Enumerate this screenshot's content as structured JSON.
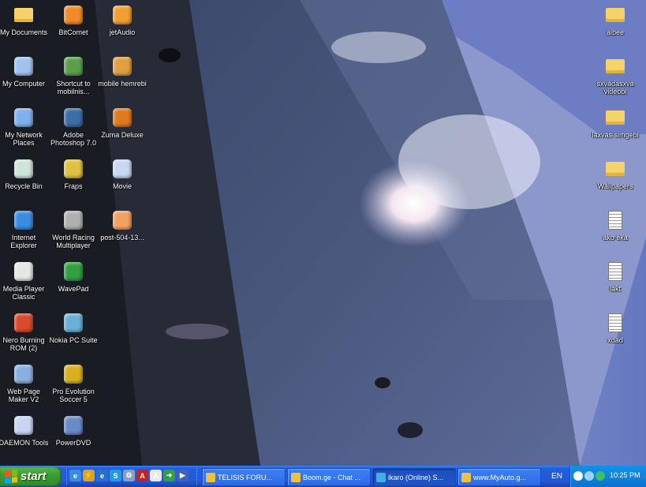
{
  "desktop": {
    "left_icons": [
      {
        "label": "My Documents",
        "icon": "folder-documents-icon",
        "color": "#f5d36b"
      },
      {
        "label": "My Computer",
        "icon": "computer-icon",
        "color": "#9fc3ee"
      },
      {
        "label": "My Network Places",
        "icon": "network-icon",
        "color": "#7fb0ec"
      },
      {
        "label": "Recycle Bin",
        "icon": "recycle-bin-icon",
        "color": "#cfe3d8"
      },
      {
        "label": "Internet Explorer",
        "icon": "internet-explorer-icon",
        "color": "#3b8be0"
      },
      {
        "label": "Media Player Classic",
        "icon": "media-player-icon",
        "color": "#e6e6e6"
      },
      {
        "label": "Nero Burning ROM (2)",
        "icon": "nero-icon",
        "color": "#d94a2a"
      },
      {
        "label": "Web Page Maker V2",
        "icon": "web-page-maker-icon",
        "color": "#8ab0e0"
      },
      {
        "label": "DAEMON Tools",
        "icon": "daemon-tools-icon",
        "color": "#c9d4f0"
      }
    ],
    "middle_icons": [
      {
        "label": "BitComet",
        "icon": "bitcomet-icon",
        "color": "#f08a2a"
      },
      {
        "label": "Shortcut to mobilnis...",
        "icon": "phone-icon",
        "color": "#5aa04a"
      },
      {
        "label": "Adobe Photoshop 7.0",
        "icon": "photoshop-icon",
        "color": "#3a6ea5"
      },
      {
        "label": "Fraps",
        "icon": "fraps-icon",
        "color": "#e0c040"
      },
      {
        "label": "World Racing Multiplayer",
        "icon": "world-racing-icon",
        "color": "#b0b0b0"
      },
      {
        "label": "WavePad",
        "icon": "wavepad-icon",
        "color": "#30a040"
      },
      {
        "label": "Nokia PC Suite",
        "icon": "nokia-icon",
        "color": "#6ab0d8"
      },
      {
        "label": "Pro Evolution Soccer 5",
        "icon": "pes-icon",
        "color": "#d8b020"
      },
      {
        "label": "PowerDVD",
        "icon": "powerdvd-icon",
        "color": "#6a8ac8"
      }
    ],
    "third_icons": [
      {
        "label": "jetAudio",
        "icon": "jetaudio-icon",
        "color": "#f0a030"
      },
      {
        "label": "mobile hemrebi",
        "icon": "mobile-icon",
        "color": "#e0a040"
      },
      {
        "label": "Zuma Deluxe",
        "icon": "zuma-icon",
        "color": "#e07a20"
      },
      {
        "label": "Movie",
        "icon": "movie-file-icon",
        "color": "#c8d8f0"
      },
      {
        "label": "post-504-13...",
        "icon": "image-file-icon",
        "color": "#f0a060"
      }
    ],
    "right_icons": [
      {
        "label": "albee",
        "icon": "folder-icon",
        "color": "#f5d36b"
      },
      {
        "label": "sxvadasxva videobi",
        "icon": "folder-icon",
        "color": "#f5d36b"
      },
      {
        "label": "laxvas simgebi",
        "icon": "folder-icon",
        "color": "#f5d36b"
      },
      {
        "label": "Wallpapers",
        "icon": "folder-icon",
        "color": "#f5d36b"
      },
      {
        "label": "ako eka",
        "icon": "text-file-icon",
        "color": "#ffffff"
      },
      {
        "label": "lakt",
        "icon": "text-file-icon",
        "color": "#ffffff"
      },
      {
        "label": "xdad",
        "icon": "text-file-icon",
        "color": "#ffffff"
      }
    ]
  },
  "taskbar": {
    "start_label": "start",
    "quick_launch": [
      {
        "icon": "ie-icon",
        "color": "#3b8be0",
        "glyph": "e"
      },
      {
        "icon": "lightning-icon",
        "color": "#e0a020",
        "glyph": "⚡"
      },
      {
        "icon": "ie-icon",
        "color": "#2a70c8",
        "glyph": "e"
      },
      {
        "icon": "skype-icon",
        "color": "#1aa0e0",
        "glyph": "S"
      },
      {
        "icon": "gear-icon",
        "color": "#8aa0c0",
        "glyph": "⚙"
      },
      {
        "icon": "acrobat-icon",
        "color": "#c82020",
        "glyph": "A"
      },
      {
        "icon": "font-icon",
        "color": "#e8e8e8",
        "glyph": "A"
      },
      {
        "icon": "arrow-icon",
        "color": "#30a040",
        "glyph": "➜"
      },
      {
        "icon": "play-icon",
        "color": "#4060c0",
        "glyph": "▶"
      }
    ],
    "tasks": [
      {
        "label": "TELISIS FORU...",
        "icon": "browser-icon",
        "color": "#f0c040",
        "active": false
      },
      {
        "label": "Boom.ge - Chat ...",
        "icon": "browser-icon",
        "color": "#f0c040",
        "active": false
      },
      {
        "label": "ikaro (Online) S...",
        "icon": "messenger-icon",
        "color": "#40b0e0",
        "active": true
      },
      {
        "label": "www.MyAuto.g...",
        "icon": "browser-icon",
        "color": "#f0c040",
        "active": false
      }
    ],
    "overflow_label": "EN",
    "tray": {
      "clock": "10:25 PM",
      "icons": [
        {
          "icon": "chevron-left-icon",
          "color": "#ffffff"
        },
        {
          "icon": "network-tray-icon",
          "color": "#a0d0ff"
        },
        {
          "icon": "messenger-tray-icon",
          "color": "#40c060"
        }
      ]
    }
  }
}
